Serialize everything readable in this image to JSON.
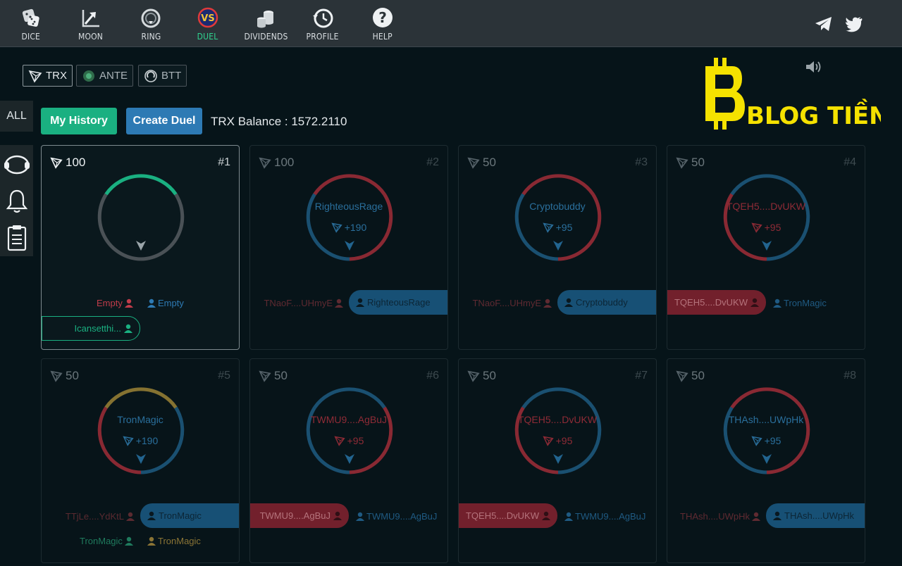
{
  "nav": {
    "items": [
      {
        "label": "DICE",
        "icon": "dice-icon"
      },
      {
        "label": "MOON",
        "icon": "moon-chart-icon"
      },
      {
        "label": "RING",
        "icon": "ring-icon"
      },
      {
        "label": "DUEL",
        "icon": "duel-vs-icon",
        "active": true
      },
      {
        "label": "DIVIDENDS",
        "icon": "coins-icon"
      },
      {
        "label": "PROFILE",
        "icon": "history-clock-icon"
      },
      {
        "label": "HELP",
        "icon": "help-icon"
      }
    ]
  },
  "currencies": [
    {
      "label": "TRX",
      "active": true
    },
    {
      "label": "ANTE",
      "active": false
    },
    {
      "label": "BTT",
      "active": false
    }
  ],
  "logo_text": "BLOG TIỀN ẢO",
  "rail": {
    "all_label": "ALL"
  },
  "actions": {
    "history_label": "My History",
    "create_label": "Create Duel",
    "balance_text": "TRX Balance : 1572.2110"
  },
  "colors": {
    "green": "#1ab081",
    "blue": "#2d7ab4",
    "red": "#c03c4a",
    "gold": "#c9a13b"
  },
  "cards": [
    {
      "amount": "100",
      "num": "#1",
      "name": "",
      "bonus": "",
      "left_player": "Empty",
      "right_player": "Empty",
      "pill_side": "none",
      "extra": "Icansetthi..."
    },
    {
      "amount": "100",
      "num": "#2",
      "name": "RighteousRage",
      "bonus": "+190",
      "left_player": "TNaoF....UHmyE",
      "right_player": "RighteousRage",
      "pill_side": "right",
      "extra": ""
    },
    {
      "amount": "50",
      "num": "#3",
      "name": "Cryptobuddy",
      "bonus": "+95",
      "left_player": "TNaoF....UHmyE",
      "right_player": "Cryptobuddy",
      "pill_side": "right",
      "extra": ""
    },
    {
      "amount": "50",
      "num": "#4",
      "name": "TQEH5....DvUKW",
      "bonus": "+95",
      "left_player": "TQEH5....DvUKW",
      "right_player": "TronMagic",
      "pill_side": "left",
      "extra": ""
    },
    {
      "amount": "50",
      "num": "#5",
      "name": "TronMagic",
      "bonus": "+190",
      "left_player": "TTjLe....YdKtL",
      "right_player": "TronMagic",
      "pill_side": "right",
      "extra": "TronMagic",
      "extra2": "TronMagic"
    },
    {
      "amount": "50",
      "num": "#6",
      "name": "TWMU9....AgBuJ",
      "bonus": "+95",
      "left_player": "TWMU9....AgBuJ",
      "right_player": "TWMU9....AgBuJ",
      "pill_side": "left",
      "extra": ""
    },
    {
      "amount": "50",
      "num": "#7",
      "name": "TQEH5....DvUKW",
      "bonus": "+95",
      "left_player": "TQEH5....DvUKW",
      "right_player": "TWMU9....AgBuJ",
      "pill_side": "left",
      "extra": ""
    },
    {
      "amount": "50",
      "num": "#8",
      "name": "THAsh....UWpHk",
      "bonus": "+95",
      "left_player": "THAsh....UWpHk",
      "right_player": "THAsh....UWpHk",
      "pill_side": "right",
      "extra": ""
    }
  ]
}
